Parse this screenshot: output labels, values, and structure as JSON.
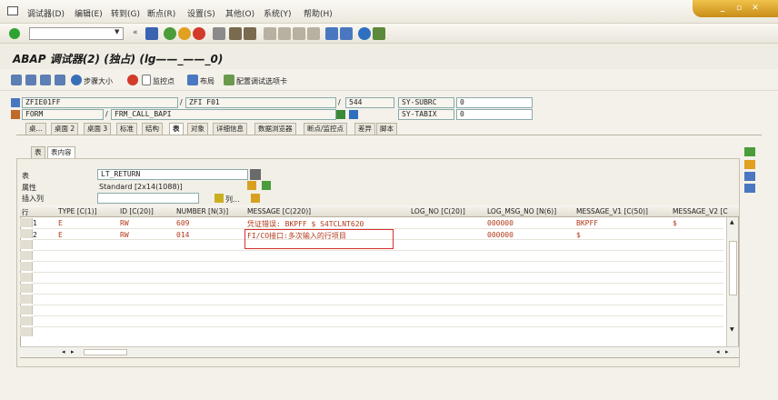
{
  "menu": [
    "调试器(D)",
    "编辑(E)",
    "转到(G)",
    "断点(R)",
    "设置(S)",
    "其他(O)",
    "系统(Y)",
    "帮助(H)"
  ],
  "toolbar2": {
    "step_size": "步骤大小",
    "watchpoint": "监控点",
    "layout": "布局",
    "config_tabs": "配置调试选项卡"
  },
  "title": "ABAP 调试器(2) (独占) (lg——_——_0)",
  "info": {
    "program": "ZFIE01FF",
    "include": "ZFI    F01",
    "line": "544",
    "event_type": "FORM",
    "event_name": "FRM_CALL_BAPI",
    "sysvar1_name": "SY-SUBRC",
    "sysvar1_value": "0",
    "sysvar2_name": "SY-TABIX",
    "sysvar2_value": "0"
  },
  "tabs": [
    "桌...",
    "桌面 2",
    "桌面 3",
    "标准",
    "结构",
    "表",
    "对象",
    "详细信息",
    "数据浏览器",
    "断点/监控点",
    "差异",
    "脚本"
  ],
  "subtabs": [
    "表",
    "表内容"
  ],
  "table_fields": {
    "table_label": "表",
    "table_value": "LT_RETURN",
    "attr_label": "属性",
    "attr_value": "Standard [2x14(1088)]",
    "insert_label": "插入列",
    "insert_value": "",
    "columns_button": "列..."
  },
  "grid": {
    "headers": [
      "行",
      "TYPE [C(1)]",
      "ID [C(20)]",
      "NUMBER [N(3)]",
      "MESSAGE [C(220)]",
      "LOG_NO [C(20)]",
      "LOG_MSG_NO [N(6)]",
      "MESSAGE_V1 [C(50)]",
      "MESSAGE_V2 [C"
    ],
    "rows": [
      [
        "1",
        "E",
        "RW",
        "609",
        "凭证错误: BKPFF $ S4TCLNT620",
        "",
        "000000",
        "BKPFF",
        "$"
      ],
      [
        "2",
        "E",
        "RW",
        "014",
        "FI/CO接口:多次输入的行项目",
        "",
        "000000",
        "$",
        ""
      ]
    ]
  }
}
